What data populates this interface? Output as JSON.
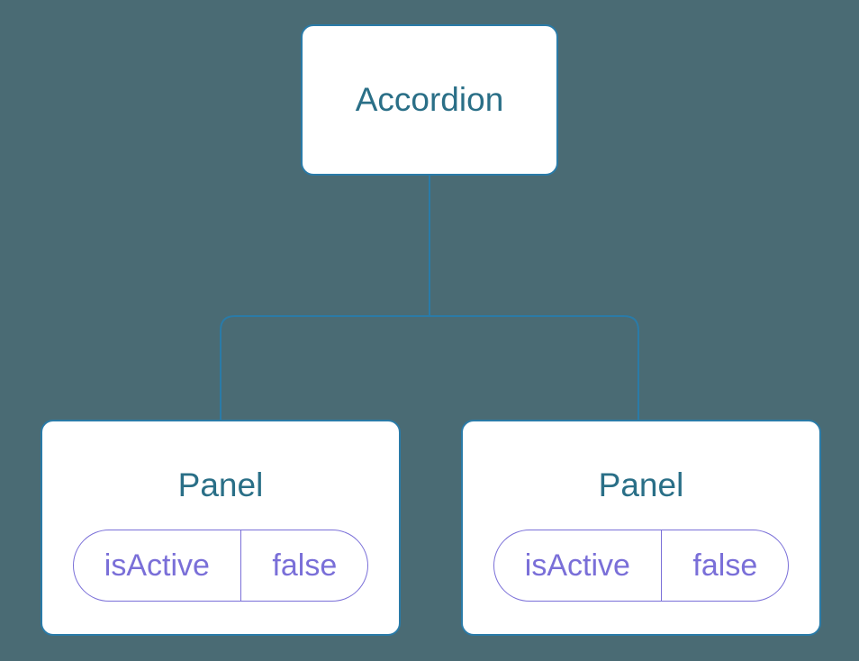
{
  "root": {
    "title": "Accordion"
  },
  "children": [
    {
      "title": "Panel",
      "state": {
        "key": "isActive",
        "value": "false"
      }
    },
    {
      "title": "Panel",
      "state": {
        "key": "isActive",
        "value": "false"
      }
    }
  ]
}
